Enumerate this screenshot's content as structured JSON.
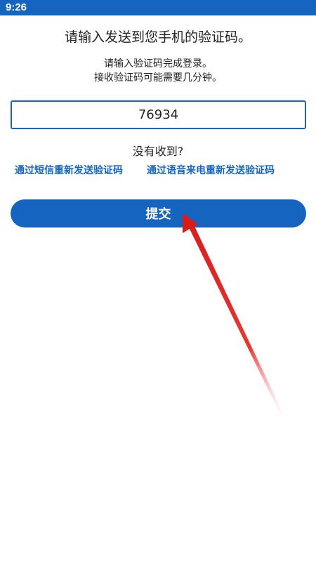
{
  "status_bar": {
    "time": "9:26"
  },
  "verify": {
    "heading": "请输入发送到您手机的验证码。",
    "subtext_line1": "请输入验证码完成登录。",
    "subtext_line2": "接收验证码可能需要几分钟。",
    "code_value": "76934",
    "not_received": "没有收到?",
    "resend_sms_label": "通过短信重新发送验证码",
    "resend_voice_label": "通过语音来电重新发送验证码",
    "submit_label": "提交"
  },
  "colors": {
    "accent": "#1565c0",
    "annotation_arrow": "#e53935"
  }
}
